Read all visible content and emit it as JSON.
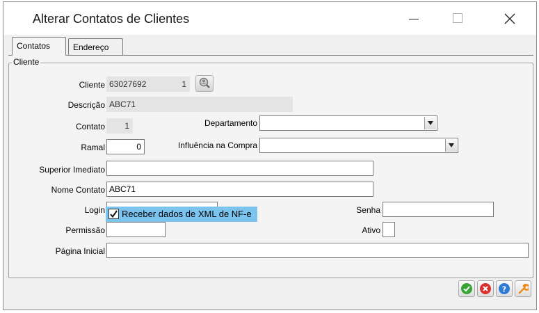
{
  "window": {
    "title": "Alterar Contatos de Clientes"
  },
  "tabs": [
    {
      "label": "Contatos",
      "active": true
    },
    {
      "label": "Endereço",
      "active": false
    }
  ],
  "group": {
    "label": "Cliente"
  },
  "form": {
    "cliente": {
      "label": "Cliente",
      "code": "63027692",
      "index": "1"
    },
    "descricao": {
      "label": "Descrição",
      "value": "ABC71"
    },
    "contato": {
      "label": "Contato",
      "value": "1"
    },
    "departamento": {
      "label": "Departamento",
      "value": ""
    },
    "ramal": {
      "label": "Ramal",
      "value": "0"
    },
    "influencia": {
      "label": "Influência na Compra",
      "value": ""
    },
    "superior": {
      "label": "Superior Imediato",
      "value": ""
    },
    "nome_contato": {
      "label": "Nome Contato",
      "value": "ABC71"
    },
    "login": {
      "label": "Login",
      "value": ""
    },
    "senha": {
      "label": "Senha",
      "value": ""
    },
    "permissao": {
      "label": "Permissão",
      "value": ""
    },
    "ativo": {
      "label": "Ativo",
      "value": ""
    },
    "pagina_inicial": {
      "label": "Página Inicial",
      "value": ""
    },
    "receber_xml": {
      "label": "Receber dados de XML de NF-e",
      "checked": true
    }
  },
  "actions": [
    {
      "name": "confirm",
      "icon": "check-icon",
      "color": "#3aa536"
    },
    {
      "name": "cancel",
      "icon": "x-circle-icon",
      "color": "#d93030"
    },
    {
      "name": "help",
      "icon": "help-icon",
      "color": "#2d7bd8"
    },
    {
      "name": "tools",
      "icon": "wrench-icon",
      "color": "#e88a1a"
    }
  ]
}
